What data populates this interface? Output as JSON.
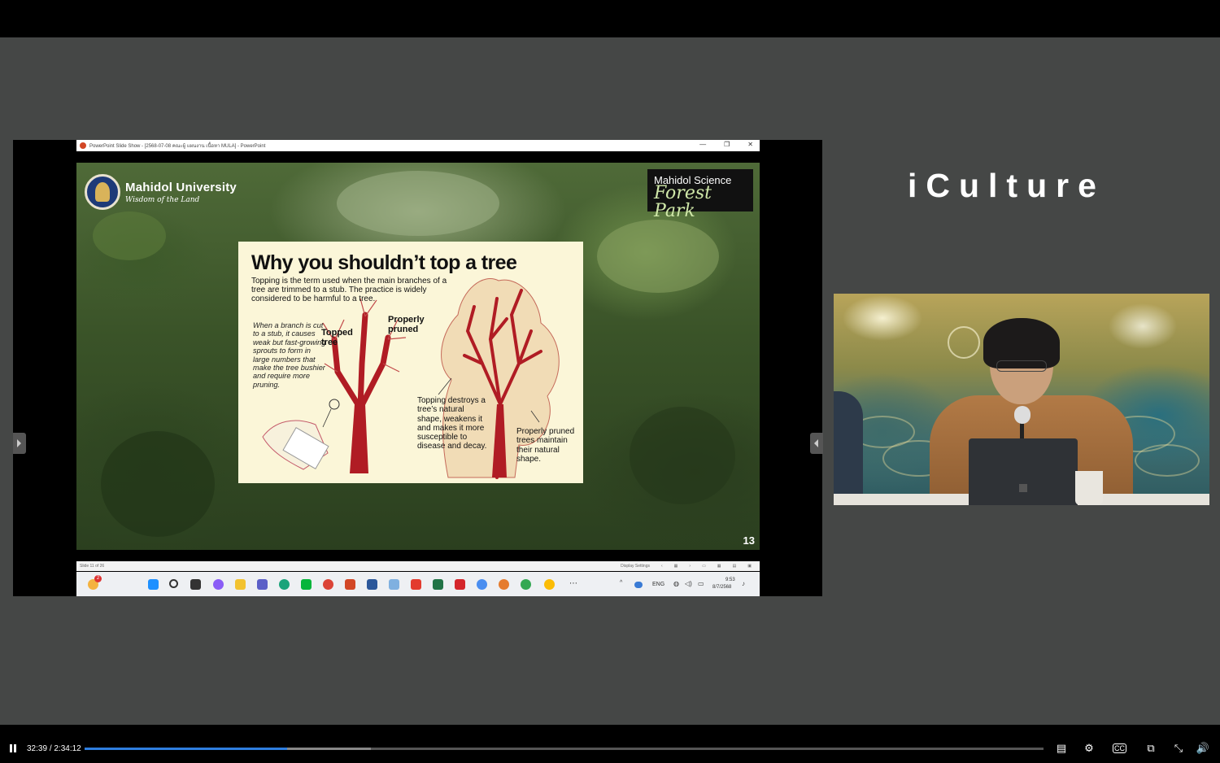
{
  "window": {
    "title": "PowerPoint Slide Show - [2568-07-08 คณะผู้ แผนงาน เนื้อหา MULA] - PowerPoint",
    "minimize": "—",
    "restore": "❐",
    "close": "✕"
  },
  "slide": {
    "university_name": "Mahidol University",
    "university_motto": "Wisdom of the Land",
    "badge_line1": "Mahidol Science",
    "badge_line2": "Forest Park",
    "number": "13",
    "infographic": {
      "title": "Why you shouldn’t top a tree",
      "intro": "Topping is the term used when the main branches of a tree are trimmed to a stub. The practice is widely considered to be harmful to a tree.",
      "note": "When a branch is cut to a stub, it causes weak but fast-growing sprouts to form in large numbers that make the tree bushier and require more pruning.",
      "label_topped": "Topped tree",
      "label_pruned": "Properly pruned",
      "caption_topping": "Topping destroys a tree’s natural shape, weakens it and makes it more susceptible to disease and decay.",
      "caption_pruned": "Properly pruned trees maintain their natural shape."
    }
  },
  "slideshow_bar": {
    "slide_counter": "Slide 11 of 26",
    "display_settings": "Display Settings"
  },
  "taskbar": {
    "language": "ENG",
    "time": "9:53",
    "date": "8/7/2568",
    "notification_count": "2"
  },
  "brand": {
    "name": "iCulture"
  },
  "player": {
    "current_time": "32:39",
    "total_time": "2:34:12",
    "progress_fraction": 0.2114,
    "buffered_fraction": 0.2985,
    "accent_color": "#2f7fe0"
  }
}
